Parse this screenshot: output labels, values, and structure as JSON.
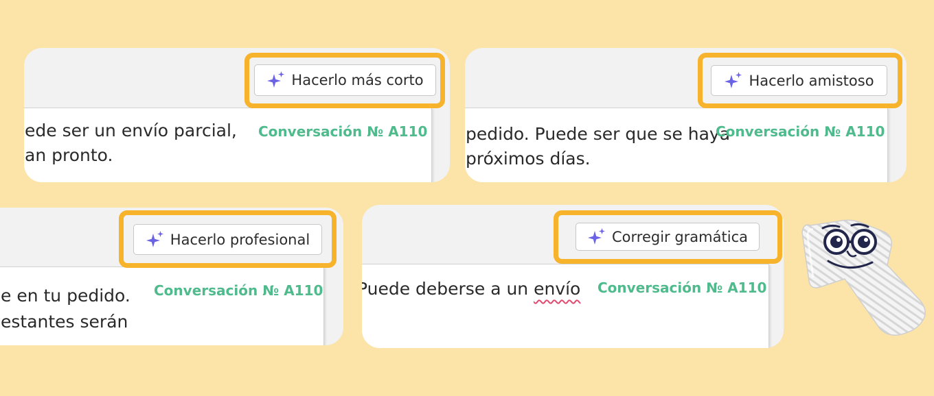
{
  "colors": {
    "background": "#fce3a7",
    "highlight": "#f6b32b",
    "conversation": "#4fba8c",
    "sparkle": "#6b63e6",
    "spell_error": "#e24a6f"
  },
  "icons": {
    "sparkle": "sparkle-icon",
    "mascot": "glasses-cursor-mascot"
  },
  "cards": [
    {
      "button_label": "Hacerlo más corto",
      "text_lines": [
        "ede ser un envío parcial,",
        "an pronto."
      ],
      "conversation_label": "Conversación № A110"
    },
    {
      "button_label": "Hacerlo amistoso",
      "text_lines": [
        "pedido. Puede ser que se haya",
        "próximos días."
      ],
      "conversation_label": "Conversación № A110"
    },
    {
      "button_label": "Hacerlo profesional",
      "text_lines": [
        "e en tu pedido.",
        "estantes serán"
      ],
      "conversation_label": "Conversación № A110"
    },
    {
      "button_label": "Corregir gramática",
      "text_prefix": "Puede deberse a un ",
      "text_misspelled": "envío",
      "conversation_label": "Conversación № A110"
    }
  ]
}
